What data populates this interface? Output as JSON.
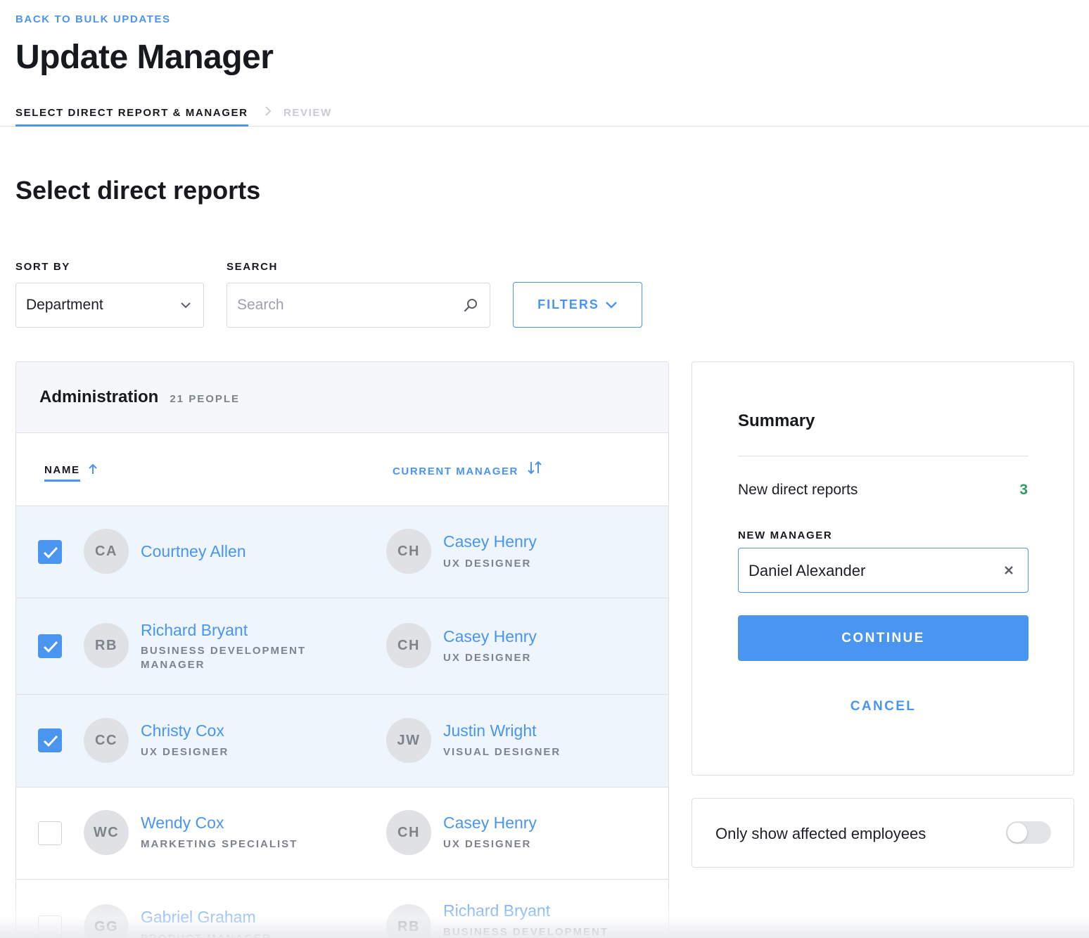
{
  "header": {
    "back_link": "BACK TO BULK UPDATES",
    "title": "Update Manager"
  },
  "steps": {
    "active": "SELECT DIRECT REPORT & MANAGER",
    "next": "REVIEW"
  },
  "section_title": "Select direct reports",
  "controls": {
    "sort_label": "SORT BY",
    "sort_value": "Department",
    "search_label": "SEARCH",
    "search_placeholder": "Search",
    "filters_label": "FILTERS"
  },
  "department": {
    "name": "Administration",
    "count": "21 PEOPLE"
  },
  "columns": {
    "name": "NAME",
    "manager": "CURRENT MANAGER"
  },
  "rows": [
    {
      "checked": true,
      "initials": "CA",
      "name": "Courtney Allen",
      "role": "",
      "manager_initials": "CH",
      "manager": "Casey Henry",
      "manager_role": "UX DESIGNER"
    },
    {
      "checked": true,
      "initials": "RB",
      "name": "Richard Bryant",
      "role": "BUSINESS DEVELOPMENT MANAGER",
      "manager_initials": "CH",
      "manager": "Casey Henry",
      "manager_role": "UX DESIGNER"
    },
    {
      "checked": true,
      "initials": "CC",
      "name": "Christy Cox",
      "role": "UX DESIGNER",
      "manager_initials": "JW",
      "manager": "Justin Wright",
      "manager_role": "VISUAL DESIGNER"
    },
    {
      "checked": false,
      "initials": "WC",
      "name": "Wendy Cox",
      "role": "MARKETING SPECIALIST",
      "manager_initials": "CH",
      "manager": "Casey Henry",
      "manager_role": "UX DESIGNER"
    },
    {
      "checked": false,
      "initials": "GG",
      "name": "Gabriel Graham",
      "role": "PRODUCT MANAGER",
      "manager_initials": "RB",
      "manager": "Richard Bryant",
      "manager_role": "BUSINESS DEVELOPMENT"
    }
  ],
  "summary": {
    "title": "Summary",
    "new_reports_label": "New direct reports",
    "new_reports_count": "3",
    "new_manager_label": "NEW MANAGER",
    "new_manager_value": "Daniel Alexander",
    "continue_label": "CONTINUE",
    "cancel_label": "CANCEL"
  },
  "toggle": {
    "label": "Only show affected employees",
    "on": false
  },
  "colors": {
    "accent": "#4a95ef",
    "success": "#2f9c63",
    "selected_row": "#eef5fd"
  }
}
